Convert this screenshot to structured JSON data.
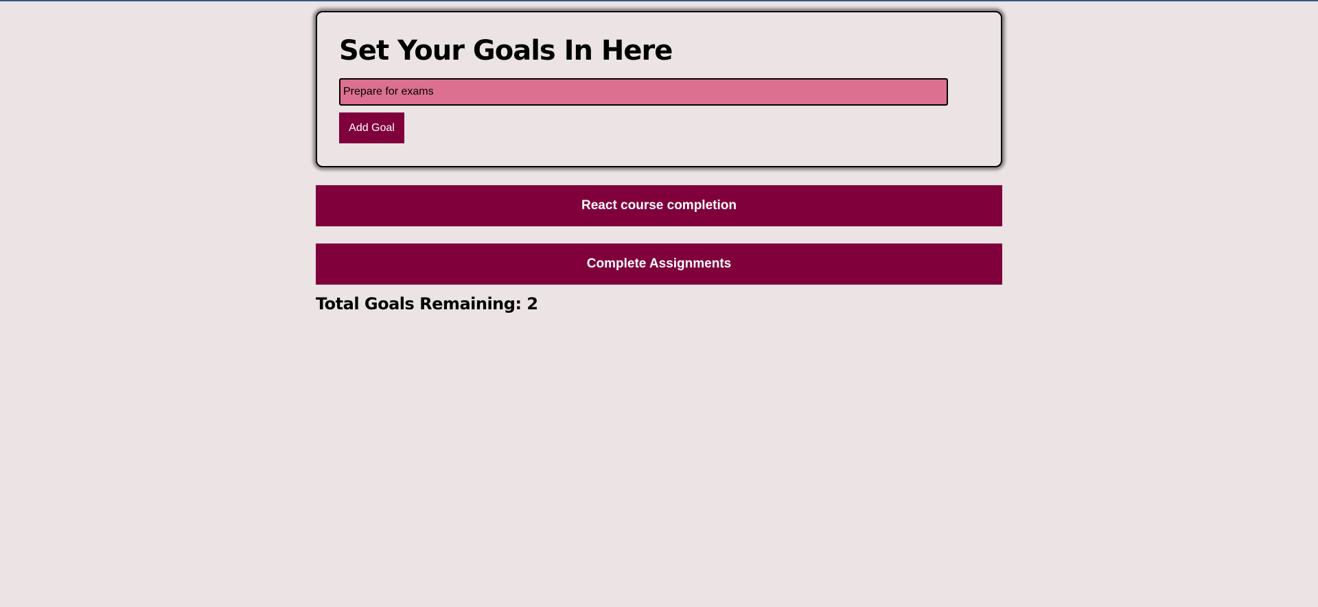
{
  "form": {
    "title": "Set Your Goals In Here",
    "input_value": "Prepare for exams",
    "add_button_label": "Add Goal"
  },
  "goals": [
    {
      "text": "React course completion"
    },
    {
      "text": "Complete Assignments"
    }
  ],
  "summary": {
    "remaining_text": "Total Goals Remaining: 2"
  },
  "colors": {
    "background": "#ebe3e4",
    "accent": "#80003c",
    "input_bg": "#dc7090"
  }
}
